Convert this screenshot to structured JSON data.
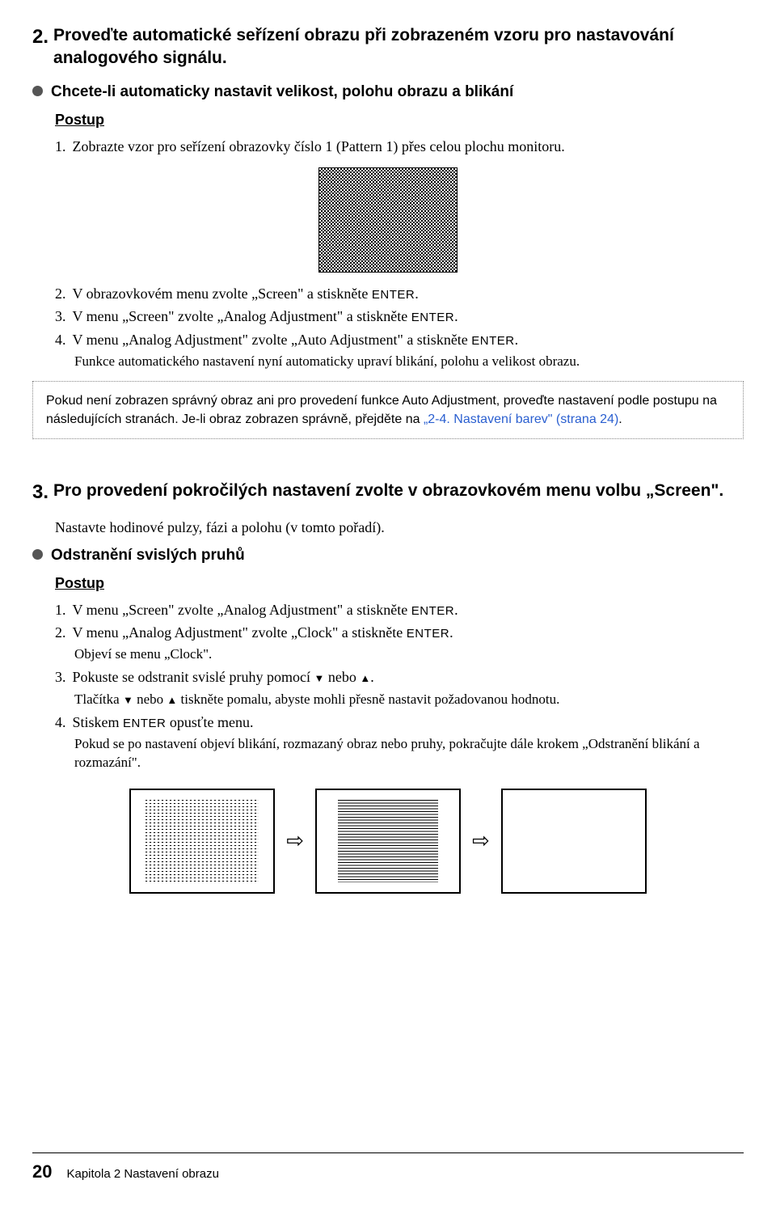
{
  "sec2": {
    "num": "2.",
    "title": "Proveďte automatické seřízení obrazu při zobrazeném vzoru pro nastavování analogového signálu.",
    "bullet": "Chcete-li automaticky nastavit velikost, polohu obrazu a blikání",
    "postup": "Postup",
    "s1": "Zobrazte vzor pro seřízení obrazovky číslo 1 (Pattern 1) přes celou plochu monitoru.",
    "s2a": "V obrazovkovém menu zvolte „Screen\" a stiskněte ",
    "s3a": "V menu „Screen\" zvolte „Analog Adjustment\" a stiskněte ",
    "s4a": "V menu „Analog Adjustment\" zvolte „Auto Adjustment\" a stiskněte ",
    "enter": "ENTER",
    "dot": ".",
    "s4note": "Funkce automatického nastavení nyní automaticky upraví blikání, polohu a velikost obrazu.",
    "box_a": "Pokud není zobrazen správný obraz ani pro provedení funkce Auto Adjustment, proveďte nastavení podle postupu na následujících stranách. Je-li obraz zobrazen správně, přejděte na ",
    "box_link": "„2-4. Nastavení barev\" (strana 24)",
    "box_b": "."
  },
  "sec3": {
    "num": "3.",
    "title": "Pro provedení pokročilých nastavení zvolte v obrazovkovém menu volbu „Screen\".",
    "sub": "Nastavte hodinové pulzy, fázi a polohu (v tomto pořadí).",
    "bullet": "Odstranění svislých pruhů",
    "postup": "Postup",
    "s1a": "V menu „Screen\" zvolte „Analog Adjustment\" a stiskněte ",
    "s2a": "V menu „Analog Adjustment\" zvolte „Clock\" a stiskněte ",
    "s2note": "Objeví se menu „Clock\".",
    "s3a": "Pokuste se odstranit svislé pruhy pomocí ",
    "s3b": " nebo ",
    "s3c": ".",
    "s3note_a": "Tlačítka ",
    "s3note_b": " nebo ",
    "s3note_c": " tiskněte pomalu, abyste mohli přesně nastavit požadovanou hodnotu.",
    "s4a": "Stiskem ",
    "s4b": " opusťte menu.",
    "s4note": "Pokud se po nastavení objeví blikání, rozmazaný obraz nebo pruhy, pokračujte dále krokem „Odstranění blikání a rozmazání\"."
  },
  "footer": {
    "page": "20",
    "chapter": "Kapitola 2 Nastavení obrazu"
  }
}
